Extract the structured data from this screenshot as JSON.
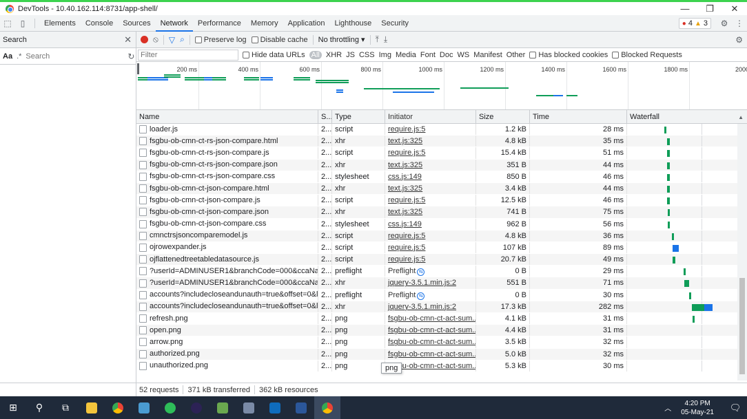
{
  "window": {
    "title": "DevTools - 10.40.162.114:8731/app-shell/"
  },
  "tabs": [
    "Elements",
    "Console",
    "Sources",
    "Network",
    "Performance",
    "Memory",
    "Application",
    "Lighthouse",
    "Security"
  ],
  "badges": {
    "errors": "4",
    "warnings": "3"
  },
  "search_panel": {
    "title": "Search",
    "aa_label": "Aa",
    "regex_label": ".*",
    "placeholder": "Search"
  },
  "toolbar": {
    "preserve_log": "Preserve log",
    "disable_cache": "Disable cache",
    "throttling": "No throttling"
  },
  "filter": {
    "placeholder": "Filter",
    "hide_data_urls": "Hide data URLs",
    "types": [
      "All",
      "XHR",
      "JS",
      "CSS",
      "Img",
      "Media",
      "Font",
      "Doc",
      "WS",
      "Manifest",
      "Other"
    ],
    "has_blocked_cookies": "Has blocked cookies",
    "blocked_requests": "Blocked Requests"
  },
  "overview_ticks": [
    "200 ms",
    "400 ms",
    "600 ms",
    "800 ms",
    "1000 ms",
    "1200 ms",
    "1400 ms",
    "1600 ms",
    "1800 ms",
    "2000"
  ],
  "columns": {
    "name": "Name",
    "status": "S...",
    "type": "Type",
    "initiator": "Initiator",
    "size": "Size",
    "time": "Time",
    "waterfall": "Waterfall"
  },
  "rows": [
    {
      "name": "loader.js",
      "status": "2...",
      "type": "script",
      "initiator": "require.js:5",
      "size": "1.2 kB",
      "time": "28 ms",
      "wf_start": 0.32,
      "wf_len": 0.02,
      "wf_color": "green"
    },
    {
      "name": "fsgbu-ob-cmn-ct-rs-json-compare.html",
      "status": "2...",
      "type": "xhr",
      "initiator": "text.js:325",
      "size": "4.8 kB",
      "time": "35 ms",
      "wf_start": 0.34,
      "wf_len": 0.025,
      "wf_color": "green"
    },
    {
      "name": "fsgbu-ob-cmn-ct-rs-json-compare.js",
      "status": "2...",
      "type": "script",
      "initiator": "require.js:5",
      "size": "15.4 kB",
      "time": "51 ms",
      "wf_start": 0.34,
      "wf_len": 0.025,
      "wf_color": "green"
    },
    {
      "name": "fsgbu-ob-cmn-ct-rs-json-compare.json",
      "status": "2...",
      "type": "xhr",
      "initiator": "text.js:325",
      "size": "351 B",
      "time": "44 ms",
      "wf_start": 0.34,
      "wf_len": 0.025,
      "wf_color": "green"
    },
    {
      "name": "fsgbu-ob-cmn-ct-rs-json-compare.css",
      "status": "2...",
      "type": "stylesheet",
      "initiator": "css.js:149",
      "size": "850 B",
      "time": "46 ms",
      "wf_start": 0.34,
      "wf_len": 0.025,
      "wf_color": "green"
    },
    {
      "name": "fsgbu-ob-cmn-ct-json-compare.html",
      "status": "2...",
      "type": "xhr",
      "initiator": "text.js:325",
      "size": "3.4 kB",
      "time": "44 ms",
      "wf_start": 0.34,
      "wf_len": 0.025,
      "wf_color": "green"
    },
    {
      "name": "fsgbu-ob-cmn-ct-json-compare.js",
      "status": "2...",
      "type": "script",
      "initiator": "require.js:5",
      "size": "12.5 kB",
      "time": "46 ms",
      "wf_start": 0.34,
      "wf_len": 0.025,
      "wf_color": "green"
    },
    {
      "name": "fsgbu-ob-cmn-ct-json-compare.json",
      "status": "2...",
      "type": "xhr",
      "initiator": "text.js:325",
      "size": "741 B",
      "time": "75 ms",
      "wf_start": 0.35,
      "wf_len": 0.02,
      "wf_color": "green"
    },
    {
      "name": "fsgbu-ob-cmn-ct-json-compare.css",
      "status": "2...",
      "type": "stylesheet",
      "initiator": "css.js:149",
      "size": "962 B",
      "time": "56 ms",
      "wf_start": 0.35,
      "wf_len": 0.02,
      "wf_color": "green"
    },
    {
      "name": "cmnctrsjsoncomparemodel.js",
      "status": "2...",
      "type": "script",
      "initiator": "require.js:5",
      "size": "4.8 kB",
      "time": "36 ms",
      "wf_start": 0.38,
      "wf_len": 0.02,
      "wf_color": "green"
    },
    {
      "name": "ojrowexpander.js",
      "status": "2...",
      "type": "script",
      "initiator": "require.js:5",
      "size": "107 kB",
      "time": "89 ms",
      "wf_start": 0.39,
      "wf_len": 0.05,
      "wf_color": "blue"
    },
    {
      "name": "ojflattenedtreetabledatasource.js",
      "status": "2...",
      "type": "script",
      "initiator": "require.js:5",
      "size": "20.7 kB",
      "time": "49 ms",
      "wf_start": 0.39,
      "wf_len": 0.025,
      "wf_color": "green"
    },
    {
      "name": "?userId=ADMINUSER1&branchCode=000&ccaName...",
      "status": "2...",
      "type": "preflight",
      "initiator": "Preflight",
      "size": "0 B",
      "time": "29 ms",
      "wf_start": 0.48,
      "wf_len": 0.02,
      "wf_color": "green"
    },
    {
      "name": "?userId=ADMINUSER1&branchCode=000&ccaName...",
      "status": "2...",
      "type": "xhr",
      "initiator": "jquery-3.5.1.min.js:2",
      "size": "551 B",
      "time": "71 ms",
      "wf_start": 0.49,
      "wf_len": 0.04,
      "wf_color": "green"
    },
    {
      "name": "accounts?includecloseandunauth=true&offset=0&li...",
      "status": "2...",
      "type": "preflight",
      "initiator": "Preflight",
      "size": "0 B",
      "time": "30 ms",
      "wf_start": 0.53,
      "wf_len": 0.02,
      "wf_color": "green"
    },
    {
      "name": "accounts?includecloseandunauth=true&offset=0&li...",
      "status": "2...",
      "type": "xhr",
      "initiator": "jquery-3.5.1.min.js:2",
      "size": "17.3 kB",
      "time": "282 ms",
      "wf_start": 0.55,
      "wf_len": 0.18,
      "wf_color": "mixed"
    },
    {
      "name": "refresh.png",
      "status": "2...",
      "type": "png",
      "initiator": "fsgbu-ob-cmn-ct-act-sum...",
      "size": "4.1 kB",
      "time": "31 ms",
      "wf_start": 0.56,
      "wf_len": 0.02,
      "wf_color": "green"
    },
    {
      "name": "open.png",
      "status": "2...",
      "type": "png",
      "initiator": "fsgbu-ob-cmn-ct-act-sum...",
      "size": "4.4 kB",
      "time": "31 ms",
      "wf_start": 0.97,
      "wf_len": 0.015,
      "wf_color": "green"
    },
    {
      "name": "arrow.png",
      "status": "2...",
      "type": "png",
      "initiator": "fsgbu-ob-cmn-ct-act-sum...",
      "size": "3.5 kB",
      "time": "32 ms",
      "wf_start": 0.97,
      "wf_len": 0.015,
      "wf_color": "green"
    },
    {
      "name": "authorized.png",
      "status": "2...",
      "type": "png",
      "initiator": "fsgbu-ob-cmn-ct-act-sum...",
      "size": "5.0 kB",
      "time": "32 ms",
      "wf_start": 0.97,
      "wf_len": 0.015,
      "wf_color": "green"
    },
    {
      "name": "unauthorized.png",
      "status": "2...",
      "type": "png",
      "initiator": "fsgbu-ob-cmn-ct-act-sum...",
      "size": "5.3 kB",
      "time": "30 ms",
      "wf_start": 0.97,
      "wf_len": 0.015,
      "wf_color": "green"
    }
  ],
  "tooltip": "png",
  "status": {
    "requests": "52 requests",
    "transferred": "371 kB transferred",
    "resources": "362 kB resources"
  },
  "clock": {
    "time": "4:20 PM",
    "date": "05-May-21"
  },
  "colors": {
    "accent": "#1a73e8",
    "waterfall_green": "#0f9d58",
    "record": "#d93025",
    "taskbar": "#1f2a3a"
  },
  "taskbar_icons": [
    "windows-start-icon",
    "search-icon",
    "task-view-icon",
    "file-explorer-icon",
    "chrome-icon",
    "app-icon",
    "app-icon",
    "eclipse-icon",
    "app-icon",
    "app-icon",
    "outlook-icon",
    "word-icon",
    "chrome-icon"
  ]
}
